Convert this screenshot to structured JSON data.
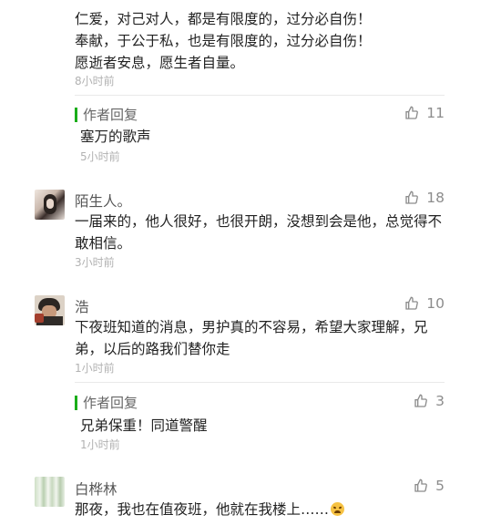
{
  "top_comment": {
    "lines": [
      "仁爱，对己对人，都是有限度的，过分必自伤！",
      "奉献，于公于私，也是有限度的，过分必自伤！",
      "愿逝者安息，愿生者自量。"
    ],
    "time": "8小时前"
  },
  "reply1": {
    "label": "作者回复",
    "text": "塞万的歌声",
    "time": "5小时前",
    "likes": "11"
  },
  "comment2": {
    "name": "陌生人。",
    "text_l1": "一届来的，他人很好，也很开朗，没想到会是他，总觉得不",
    "text_l2": "敢相信。",
    "time": "3小时前",
    "likes": "18"
  },
  "comment3": {
    "name": "浩",
    "text_l1": "下夜班知道的消息，男护真的不容易，希望大家理解，兄",
    "text_l2": "弟，以后的路我们替你走",
    "time": "1小时前",
    "likes": "10"
  },
  "reply3": {
    "label": "作者回复",
    "text": "兄弟保重！同道警醒",
    "time": "1小时前",
    "likes": "3"
  },
  "comment4": {
    "name": "白桦林",
    "text": "那夜，我也在值夜班，他就在我楼上……",
    "likes": "5"
  },
  "colors": {
    "accent": "#1aad19",
    "time": "#b2b2b2"
  },
  "icons": {
    "like": "thumbs-up-icon",
    "emoji": "sad-face-emoji"
  }
}
